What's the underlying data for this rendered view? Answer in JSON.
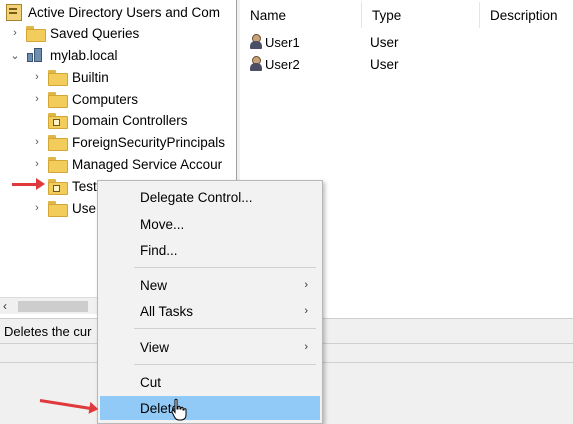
{
  "tree": {
    "root_label": "Active Directory Users and Com",
    "items": [
      {
        "label": "Saved Queries"
      },
      {
        "label": "mylab.local"
      },
      {
        "label": "Builtin"
      },
      {
        "label": "Computers"
      },
      {
        "label": "Domain Controllers"
      },
      {
        "label": "ForeignSecurityPrincipals"
      },
      {
        "label": "Managed Service Accour"
      },
      {
        "label": "Test OU"
      },
      {
        "label": "Use"
      }
    ]
  },
  "list": {
    "columns": [
      "Name",
      "Type",
      "Description"
    ],
    "rows": [
      {
        "name": "User1",
        "type": "User"
      },
      {
        "name": "User2",
        "type": "User"
      }
    ]
  },
  "context_menu": {
    "items": [
      {
        "label": "Delegate Control..."
      },
      {
        "label": "Move..."
      },
      {
        "label": "Find..."
      },
      {
        "label": "New"
      },
      {
        "label": "All Tasks"
      },
      {
        "label": "View"
      },
      {
        "label": "Cut"
      },
      {
        "label": "Delete"
      }
    ],
    "highlight_color": "#91c9f7"
  },
  "status_bar": {
    "text": "Deletes the cur"
  },
  "icons": {
    "expand": "chevron-right-icon",
    "collapse": "chevron-down-icon",
    "folder": "folder-icon",
    "user": "user-icon",
    "domain": "domain-icon",
    "ad_root": "active-directory-icon",
    "submenu": "submenu-arrow-icon",
    "scroll_left": "scroll-left-arrow-icon"
  },
  "annotation_color": "#e0393c"
}
